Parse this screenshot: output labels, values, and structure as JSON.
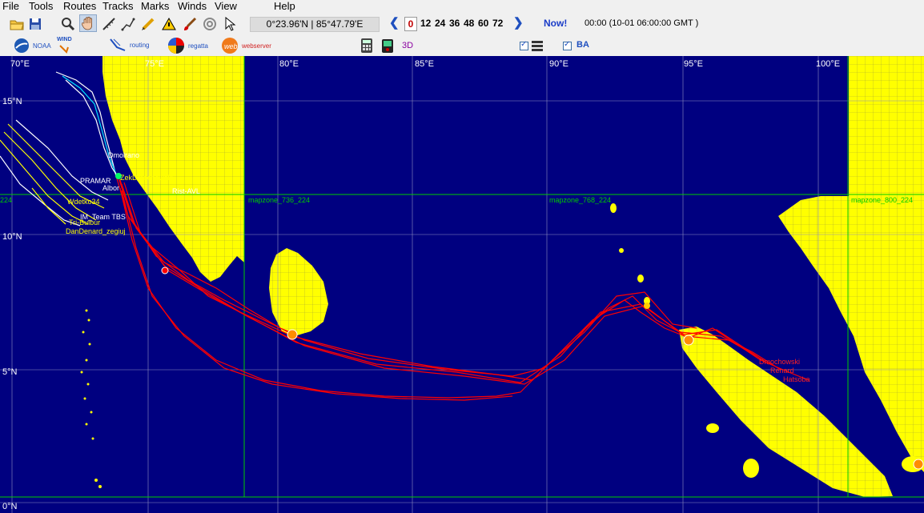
{
  "menubar": {
    "file": "File",
    "tools": "Tools",
    "routes": "Routes",
    "tracks": "Tracks",
    "marks": "Marks",
    "winds": "Winds",
    "view": "View",
    "help": "Help"
  },
  "toolbar": {
    "coords": "0°23.96'N | 85°47.79'E",
    "hours": [
      "0",
      "12",
      "24",
      "36",
      "48",
      "60",
      "72"
    ],
    "now_label": "Now!",
    "time_info": "00:00 (10-01 06:00:00 GMT )",
    "noaa_label": "NOAA",
    "wind_label": "WIND",
    "routing_label": "routing",
    "regatta_label": "regatta",
    "webserver_label": "webserver",
    "three_d_label": "3D",
    "ba_label": "BA",
    "icons": [
      "open-folder-icon",
      "save-icon",
      "zoom-icon",
      "hand-pan-icon",
      "ruler-icon",
      "route-icon",
      "pencil-icon",
      "brush-icon",
      "target-icon",
      "pointer-icon"
    ]
  },
  "map": {
    "lon_labels": [
      "70°E",
      "75°E",
      "80°E",
      "85°E",
      "90°E",
      "95°E",
      "100°E"
    ],
    "lat_labels": [
      "10°N",
      "5°N",
      "0°N"
    ],
    "top_lat_label": "15°N",
    "zones": [
      "mapzone_736_224",
      "mapzone_768_224",
      "mapzone_800_224"
    ],
    "zone_left_stub": "224",
    "boats": [
      "Dmolrano",
      "PRAMAR",
      "ZekDmochowski",
      "Albor",
      "Wdetko34",
      "IM_Team TBS",
      "Tri-Bulbur",
      "DanDenard_zegiuj",
      "Dmochowski",
      "Renard",
      "Hatsoba",
      "Rist-AVL"
    ],
    "colors": {
      "sea": "#000080",
      "land": "#ffff00",
      "track": "#ff0000",
      "grid": "#00cc00"
    }
  }
}
